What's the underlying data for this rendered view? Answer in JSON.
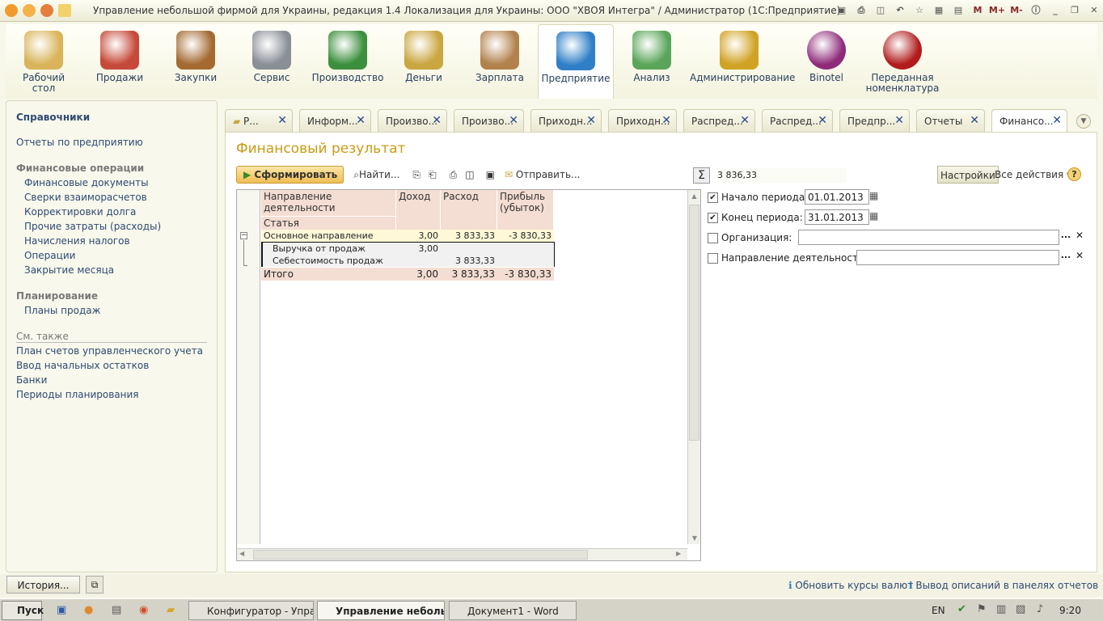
{
  "window": {
    "title": "Управление небольшой фирмой для Украины, редакция 1.4 Локализация для Украины: ООО \"ХВОЯ Интегра\" / Администратор  (1С:Предприятие)",
    "mem": [
      "M",
      "M+",
      "M-"
    ]
  },
  "sections": [
    {
      "label": "Рабочий\nстол",
      "icon": "desk-icon",
      "color": "#d9b45a"
    },
    {
      "label": "Продажи",
      "icon": "basket-icon",
      "color": "#c64a3a"
    },
    {
      "label": "Закупки",
      "icon": "boxes-icon",
      "color": "#a46a32"
    },
    {
      "label": "Сервис",
      "icon": "tools-icon",
      "color": "#8a8f96"
    },
    {
      "label": "Производство",
      "icon": "factory-icon",
      "color": "#3c8f3c"
    },
    {
      "label": "Деньги",
      "icon": "coins-icon",
      "color": "#c9a640"
    },
    {
      "label": "Зарплата",
      "icon": "person-icon",
      "color": "#b2814c"
    },
    {
      "label": "Предприятие",
      "icon": "building-icon",
      "color": "#2f7fc6"
    },
    {
      "label": "Анализ",
      "icon": "analysis-icon",
      "color": "#5aa55a"
    },
    {
      "label": "Администрирование",
      "icon": "admin-icon",
      "color": "#d1a324"
    },
    {
      "label": "Binotel",
      "icon": "binotel-icon",
      "color": "#8e2a7a"
    },
    {
      "label": "Переданная\nноменклатура",
      "icon": "coffee-icon",
      "color": "#b11b1b"
    }
  ],
  "sidebar": {
    "title": "Справочники",
    "reports": "Отчеты по предприятию",
    "fin_head": "Финансовые операции",
    "fin_items": [
      "Финансовые документы",
      "Сверки взаиморасчетов",
      "Корректировки долга",
      "Прочие затраты (расходы)",
      "Начисления налогов",
      "Операции",
      "Закрытие месяца"
    ],
    "plan_head": "Планирование",
    "plan_items": [
      "Планы продаж"
    ],
    "see_head": "См. также",
    "see_items": [
      "План счетов управленческого учета",
      "Ввод начальных остатков",
      "Банки",
      "Периоды планирования"
    ]
  },
  "tabs": [
    "Р...",
    "Информ...",
    "Произво...",
    "Произво...",
    "Приходн...",
    "Приходн...",
    "Распред...",
    "Распред...",
    "Предпр...",
    "Отчеты",
    "Финансо..."
  ],
  "report": {
    "title": "Финансовый результат",
    "form_btn": "Сформировать",
    "find_btn": "Найти...",
    "send_btn": "Отправить...",
    "sum_value": "3 836,33",
    "settings_btn": "Настройки",
    "all_actions": "Все действия",
    "headers": {
      "dir": "Направление деятельности",
      "article": "Статья",
      "income": "Доход",
      "expense": "Расход",
      "profit": "Прибыль (убыток)"
    },
    "rows": [
      {
        "name": "Основное направление",
        "income": "3,00",
        "expense": "3 833,33",
        "profit": "-3 830,33"
      },
      {
        "name": "Выручка от продаж",
        "income": "3,00",
        "expense": "",
        "profit": ""
      },
      {
        "name": "Себестоимость продаж",
        "income": "",
        "expense": "3 833,33",
        "profit": ""
      }
    ],
    "total": {
      "name": "Итого",
      "income": "3,00",
      "expense": "3 833,33",
      "profit": "-3 830,33"
    }
  },
  "params": {
    "start_label": "Начало периода:",
    "start_value": "01.01.2013",
    "end_label": "Конец периода:",
    "end_value": "31.01.2013",
    "org_label": "Организация:",
    "dir_label": "Направление деятельности:"
  },
  "status": {
    "history": "История...",
    "link1": "Обновить курсы валют",
    "link2": "Вывод описаний в панелях отчетов"
  },
  "taskbar": {
    "start": "Пуск",
    "tasks": [
      "Конфигуратор - Управ...",
      "Управление неболь...",
      "Документ1 - Word"
    ],
    "lang": "EN",
    "time": "9:20"
  }
}
